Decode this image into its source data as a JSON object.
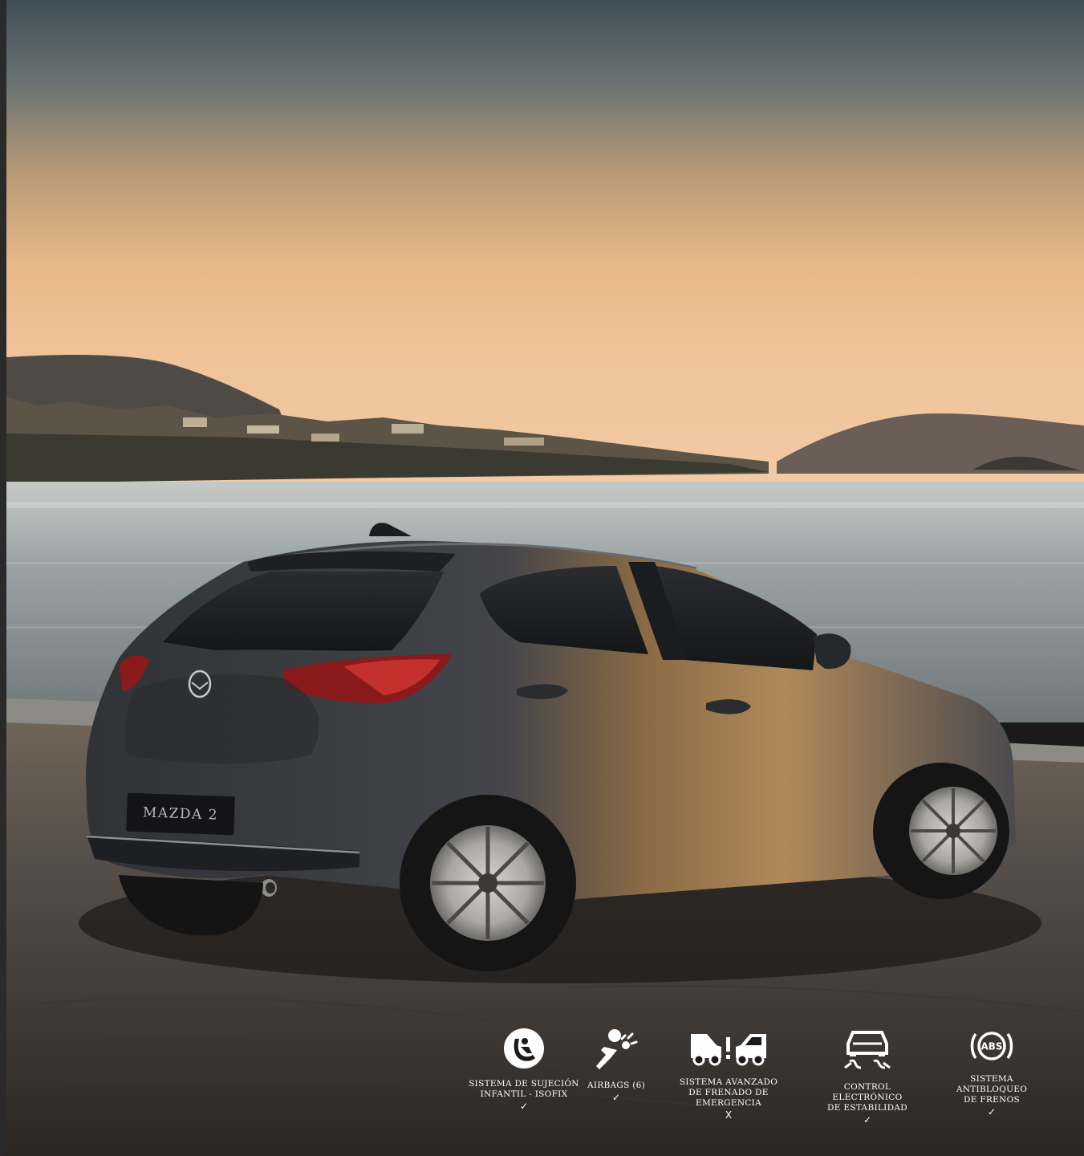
{
  "badge": {
    "model": "MAZDA 2"
  },
  "features": [
    {
      "icon": "child-seat-icon",
      "label": "SISTEMA DE SUJECIÓN\nINFANTIL - ISOFIX",
      "status": "✓"
    },
    {
      "icon": "airbag-icon",
      "label": "AIRBAGS (6)",
      "status": "✓"
    },
    {
      "icon": "collision-warning-icon",
      "label": "SISTEMA AVANZADO\nDE FRENADO DE EMERGENCIA",
      "status": "X"
    },
    {
      "icon": "stability-control-icon",
      "label": "CONTROL ELECTRÓNICO\nDE ESTABILIDAD",
      "status": "✓"
    },
    {
      "icon": "abs-icon",
      "label": "SISTEMA ANTIBLOQUEO\nDE FRENOS",
      "status": "✓",
      "icon_text": "ABS"
    }
  ]
}
